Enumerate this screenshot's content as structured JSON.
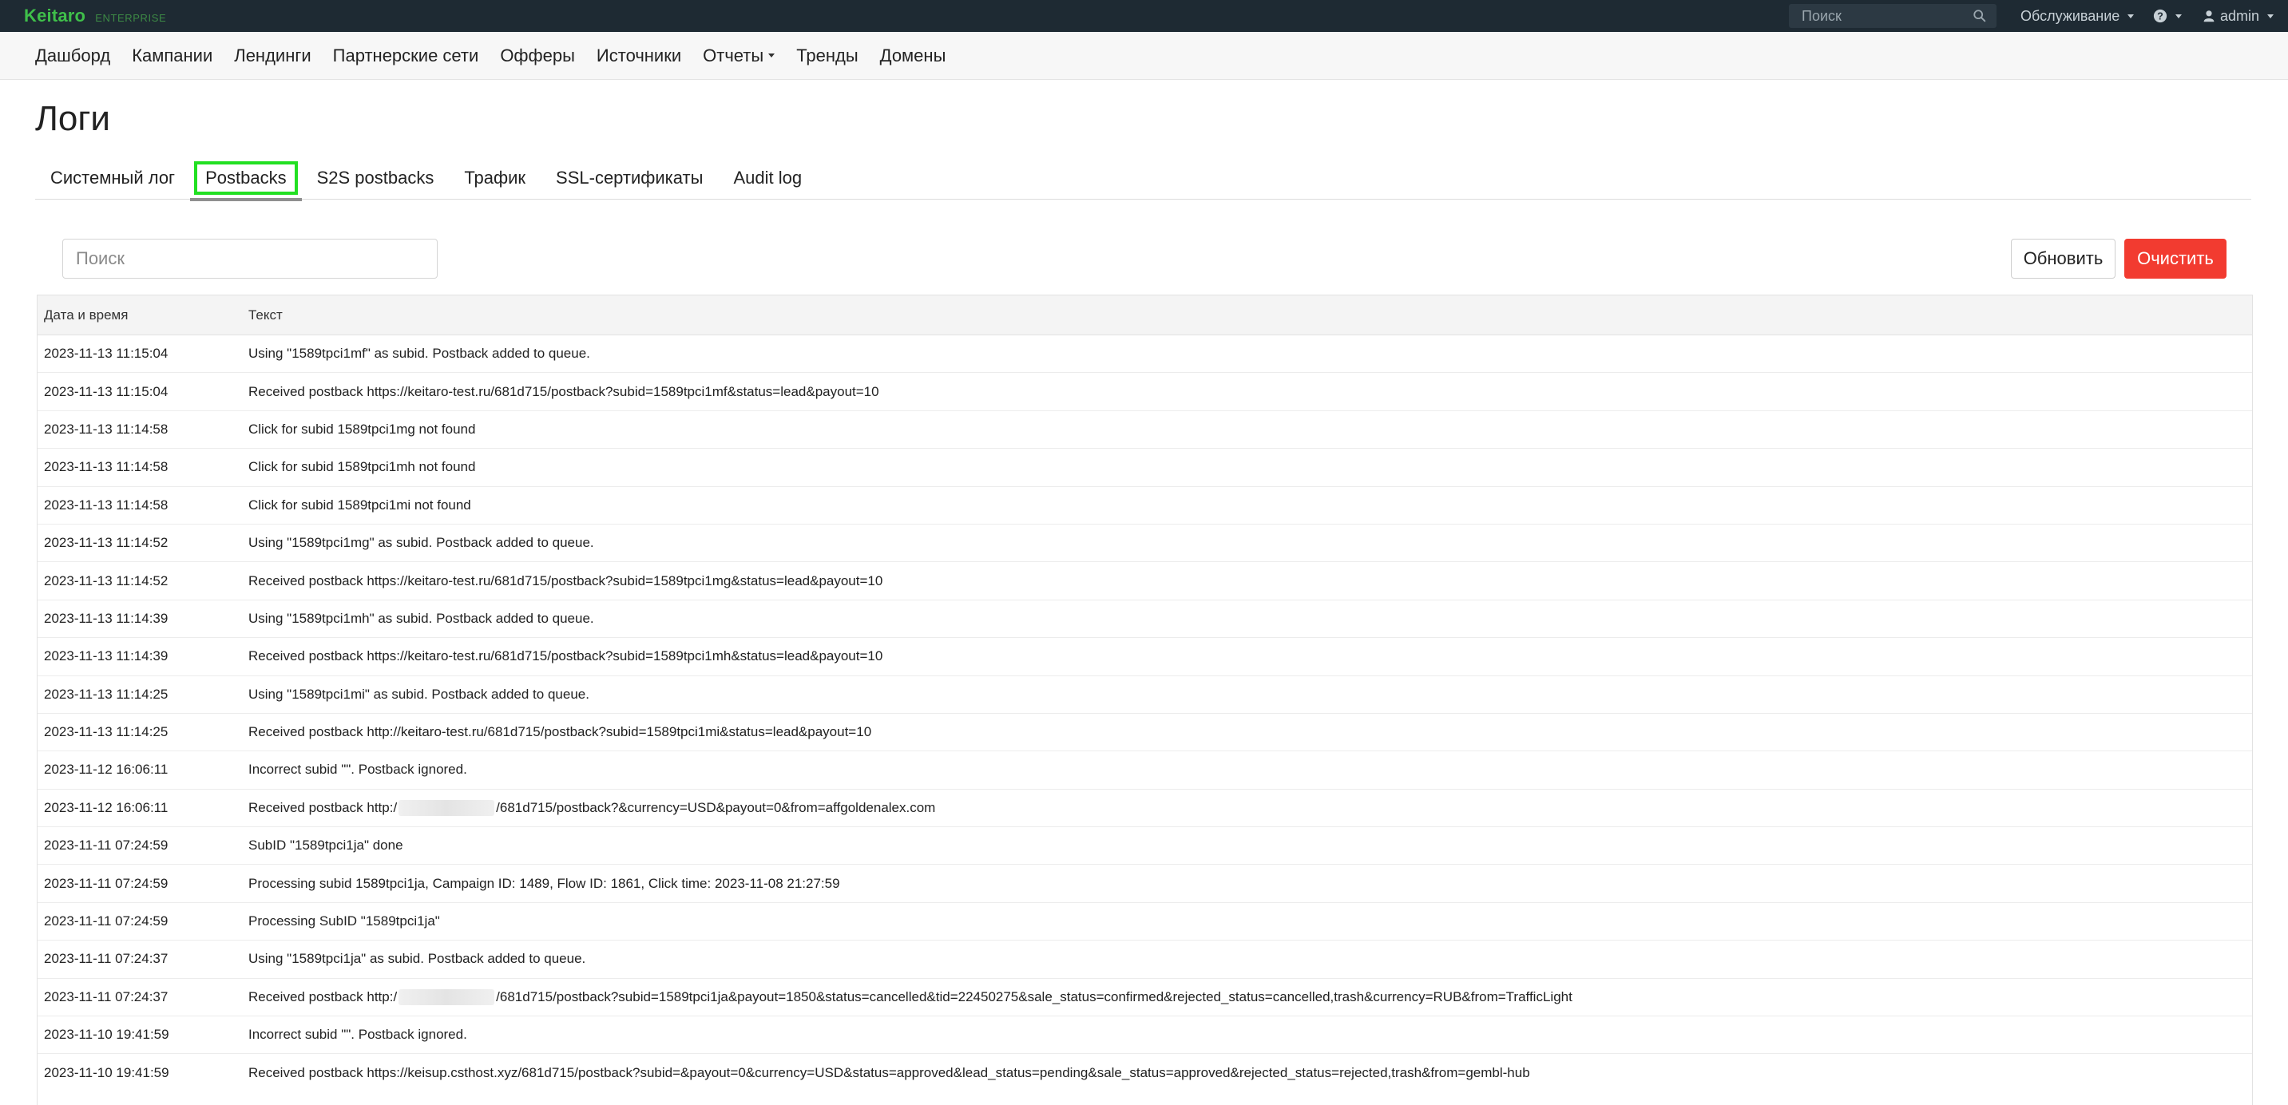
{
  "topbar": {
    "brand": "Keitaro",
    "edition": "ENTERPRISE",
    "search_placeholder": "Поиск",
    "maintenance_label": "Обслуживание",
    "help_label": "?",
    "user_label": "admin"
  },
  "nav": {
    "items": [
      "Дашборд",
      "Кампании",
      "Лендинги",
      "Партнерские сети",
      "Офферы",
      "Источники",
      "Отчеты",
      "Тренды",
      "Домены"
    ]
  },
  "page": {
    "title": "Логи"
  },
  "tabs": [
    "Системный лог",
    "Postbacks",
    "S2S postbacks",
    "Трафик",
    "SSL-сертификаты",
    "Audit log"
  ],
  "active_tab": "Postbacks",
  "controls": {
    "search_placeholder": "Поиск",
    "refresh_label": "Обновить",
    "clear_label": "Очистить"
  },
  "colors": {
    "accent_green": "#3fbf4a",
    "highlight_green": "#22e022",
    "danger_red": "#f23b30",
    "topbar_bg": "#1e2a33"
  },
  "table": {
    "headers": [
      "Дата и время",
      "Текст"
    ],
    "rows": [
      {
        "time": "2023-11-13 11:15:04",
        "text": "Using \"1589tpci1mf\" as subid. Postback added to queue."
      },
      {
        "time": "2023-11-13 11:15:04",
        "text": "Received postback https://keitaro-test.ru/681d715/postback?subid=1589tpci1mf&status=lead&payout=10"
      },
      {
        "time": "2023-11-13 11:14:58",
        "text": "Click for subid 1589tpci1mg not found"
      },
      {
        "time": "2023-11-13 11:14:58",
        "text": "Click for subid 1589tpci1mh not found"
      },
      {
        "time": "2023-11-13 11:14:58",
        "text": "Click for subid 1589tpci1mi not found"
      },
      {
        "time": "2023-11-13 11:14:52",
        "text": "Using \"1589tpci1mg\" as subid. Postback added to queue."
      },
      {
        "time": "2023-11-13 11:14:52",
        "text": "Received postback https://keitaro-test.ru/681d715/postback?subid=1589tpci1mg&status=lead&payout=10"
      },
      {
        "time": "2023-11-13 11:14:39",
        "text": "Using \"1589tpci1mh\" as subid. Postback added to queue."
      },
      {
        "time": "2023-11-13 11:14:39",
        "text": "Received postback https://keitaro-test.ru/681d715/postback?subid=1589tpci1mh&status=lead&payout=10"
      },
      {
        "time": "2023-11-13 11:14:25",
        "text": "Using \"1589tpci1mi\" as subid. Postback added to queue."
      },
      {
        "time": "2023-11-13 11:14:25",
        "text": "Received postback http://keitaro-test.ru/681d715/postback?subid=1589tpci1mi&status=lead&payout=10"
      },
      {
        "time": "2023-11-12 16:06:11",
        "text": "Incorrect subid \"\". Postback ignored."
      },
      {
        "time": "2023-11-12 16:06:11",
        "text_prefix": "Received postback http:/",
        "text": "/681d715/postback?&currency=USD&payout=0&from=affgoldenalex.com"
      },
      {
        "time": "2023-11-11 07:24:59",
        "text": "SubID \"1589tpci1ja\" done"
      },
      {
        "time": "2023-11-11 07:24:59",
        "text": "Processing subid 1589tpci1ja, Campaign ID: 1489, Flow ID: 1861, Click time: 2023-11-08 21:27:59"
      },
      {
        "time": "2023-11-11 07:24:59",
        "text": "Processing SubID \"1589tpci1ja\""
      },
      {
        "time": "2023-11-11 07:24:37",
        "text": "Using \"1589tpci1ja\" as subid. Postback added to queue."
      },
      {
        "time": "2023-11-11 07:24:37",
        "text_prefix": "Received postback http:/",
        "text": "/681d715/postback?subid=1589tpci1ja&payout=1850&status=cancelled&tid=22450275&sale_status=confirmed&rejected_status=cancelled,trash&currency=RUB&from=TrafficLight"
      },
      {
        "time": "2023-11-10 19:41:59",
        "text": "Incorrect subid \"\". Postback ignored."
      },
      {
        "time": "2023-11-10 19:41:59",
        "text": "Received postback https://keisup.csthost.xyz/681d715/postback?subid=&payout=0&currency=USD&status=approved&lead_status=pending&sale_status=approved&rejected_status=rejected,trash&from=gembl-hub"
      }
    ]
  }
}
